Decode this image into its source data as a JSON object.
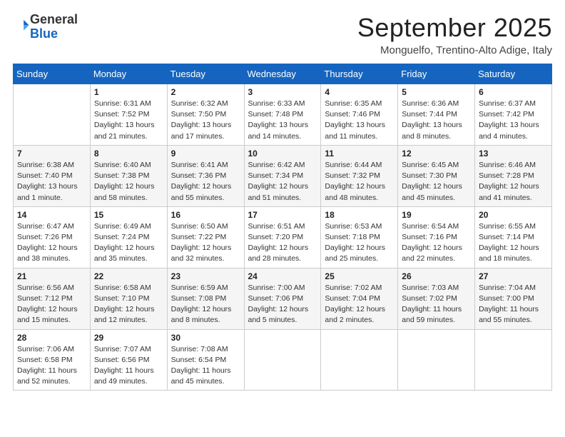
{
  "logo": {
    "general": "General",
    "blue": "Blue"
  },
  "title": "September 2025",
  "location": "Monguelfo, Trentino-Alto Adige, Italy",
  "weekdays": [
    "Sunday",
    "Monday",
    "Tuesday",
    "Wednesday",
    "Thursday",
    "Friday",
    "Saturday"
  ],
  "weeks": [
    [
      {
        "day": "",
        "info": ""
      },
      {
        "day": "1",
        "info": "Sunrise: 6:31 AM\nSunset: 7:52 PM\nDaylight: 13 hours and 21 minutes."
      },
      {
        "day": "2",
        "info": "Sunrise: 6:32 AM\nSunset: 7:50 PM\nDaylight: 13 hours and 17 minutes."
      },
      {
        "day": "3",
        "info": "Sunrise: 6:33 AM\nSunset: 7:48 PM\nDaylight: 13 hours and 14 minutes."
      },
      {
        "day": "4",
        "info": "Sunrise: 6:35 AM\nSunset: 7:46 PM\nDaylight: 13 hours and 11 minutes."
      },
      {
        "day": "5",
        "info": "Sunrise: 6:36 AM\nSunset: 7:44 PM\nDaylight: 13 hours and 8 minutes."
      },
      {
        "day": "6",
        "info": "Sunrise: 6:37 AM\nSunset: 7:42 PM\nDaylight: 13 hours and 4 minutes."
      }
    ],
    [
      {
        "day": "7",
        "info": "Sunrise: 6:38 AM\nSunset: 7:40 PM\nDaylight: 13 hours and 1 minute."
      },
      {
        "day": "8",
        "info": "Sunrise: 6:40 AM\nSunset: 7:38 PM\nDaylight: 12 hours and 58 minutes."
      },
      {
        "day": "9",
        "info": "Sunrise: 6:41 AM\nSunset: 7:36 PM\nDaylight: 12 hours and 55 minutes."
      },
      {
        "day": "10",
        "info": "Sunrise: 6:42 AM\nSunset: 7:34 PM\nDaylight: 12 hours and 51 minutes."
      },
      {
        "day": "11",
        "info": "Sunrise: 6:44 AM\nSunset: 7:32 PM\nDaylight: 12 hours and 48 minutes."
      },
      {
        "day": "12",
        "info": "Sunrise: 6:45 AM\nSunset: 7:30 PM\nDaylight: 12 hours and 45 minutes."
      },
      {
        "day": "13",
        "info": "Sunrise: 6:46 AM\nSunset: 7:28 PM\nDaylight: 12 hours and 41 minutes."
      }
    ],
    [
      {
        "day": "14",
        "info": "Sunrise: 6:47 AM\nSunset: 7:26 PM\nDaylight: 12 hours and 38 minutes."
      },
      {
        "day": "15",
        "info": "Sunrise: 6:49 AM\nSunset: 7:24 PM\nDaylight: 12 hours and 35 minutes."
      },
      {
        "day": "16",
        "info": "Sunrise: 6:50 AM\nSunset: 7:22 PM\nDaylight: 12 hours and 32 minutes."
      },
      {
        "day": "17",
        "info": "Sunrise: 6:51 AM\nSunset: 7:20 PM\nDaylight: 12 hours and 28 minutes."
      },
      {
        "day": "18",
        "info": "Sunrise: 6:53 AM\nSunset: 7:18 PM\nDaylight: 12 hours and 25 minutes."
      },
      {
        "day": "19",
        "info": "Sunrise: 6:54 AM\nSunset: 7:16 PM\nDaylight: 12 hours and 22 minutes."
      },
      {
        "day": "20",
        "info": "Sunrise: 6:55 AM\nSunset: 7:14 PM\nDaylight: 12 hours and 18 minutes."
      }
    ],
    [
      {
        "day": "21",
        "info": "Sunrise: 6:56 AM\nSunset: 7:12 PM\nDaylight: 12 hours and 15 minutes."
      },
      {
        "day": "22",
        "info": "Sunrise: 6:58 AM\nSunset: 7:10 PM\nDaylight: 12 hours and 12 minutes."
      },
      {
        "day": "23",
        "info": "Sunrise: 6:59 AM\nSunset: 7:08 PM\nDaylight: 12 hours and 8 minutes."
      },
      {
        "day": "24",
        "info": "Sunrise: 7:00 AM\nSunset: 7:06 PM\nDaylight: 12 hours and 5 minutes."
      },
      {
        "day": "25",
        "info": "Sunrise: 7:02 AM\nSunset: 7:04 PM\nDaylight: 12 hours and 2 minutes."
      },
      {
        "day": "26",
        "info": "Sunrise: 7:03 AM\nSunset: 7:02 PM\nDaylight: 11 hours and 59 minutes."
      },
      {
        "day": "27",
        "info": "Sunrise: 7:04 AM\nSunset: 7:00 PM\nDaylight: 11 hours and 55 minutes."
      }
    ],
    [
      {
        "day": "28",
        "info": "Sunrise: 7:06 AM\nSunset: 6:58 PM\nDaylight: 11 hours and 52 minutes."
      },
      {
        "day": "29",
        "info": "Sunrise: 7:07 AM\nSunset: 6:56 PM\nDaylight: 11 hours and 49 minutes."
      },
      {
        "day": "30",
        "info": "Sunrise: 7:08 AM\nSunset: 6:54 PM\nDaylight: 11 hours and 45 minutes."
      },
      {
        "day": "",
        "info": ""
      },
      {
        "day": "",
        "info": ""
      },
      {
        "day": "",
        "info": ""
      },
      {
        "day": "",
        "info": ""
      }
    ]
  ]
}
